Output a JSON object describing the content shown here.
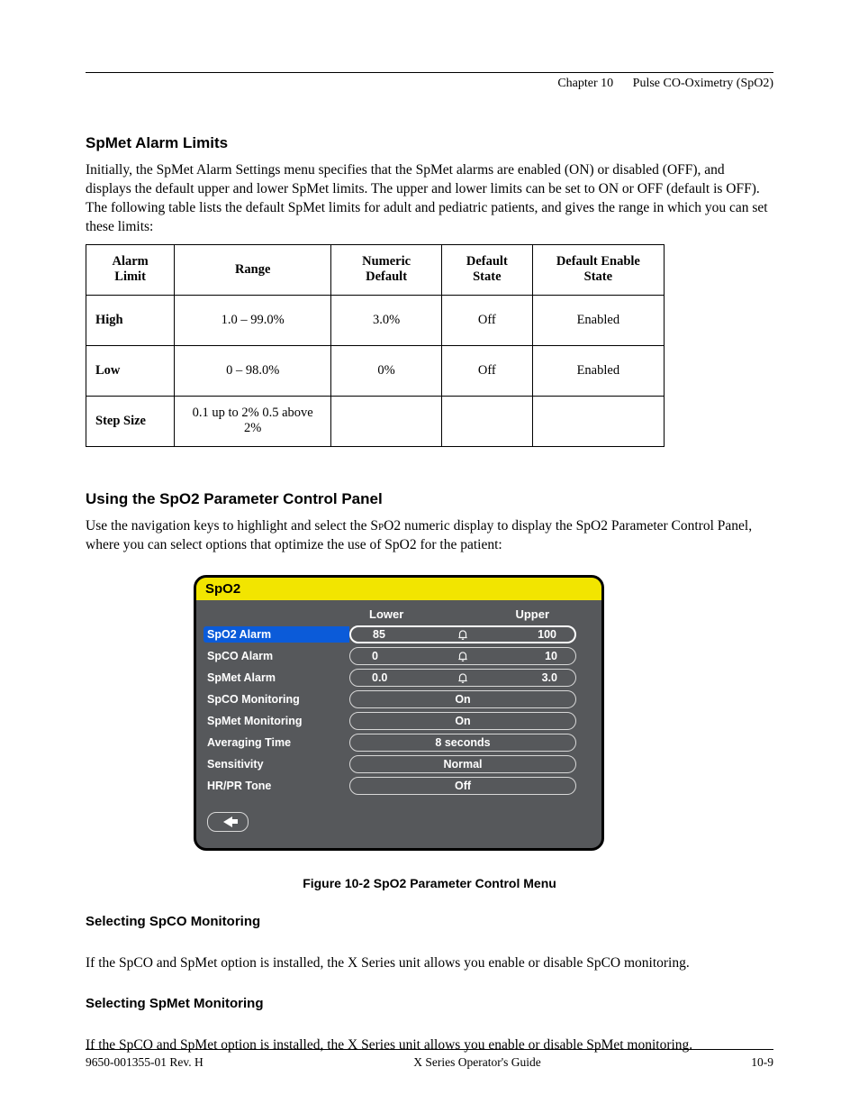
{
  "header": {
    "chapter": "Chapter 10",
    "section": "Pulse CO-Oximetry (SpO2)"
  },
  "spmet": {
    "title": "SpMet Alarm Limits",
    "intro": "Initially, the SpMet Alarm Settings menu specifies that the SpMet alarms are enabled (ON) or disabled (OFF), and displays the default upper and lower SpMet limits. The upper and lower limits can be set to ON or OFF (default is OFF). The following table lists the default SpMet limits for adult and pediatric patients, and gives the range in which you can set these limits:",
    "table": {
      "headers": [
        "Alarm Limit",
        "Range",
        "Numeric Default",
        "Default State",
        "Default Enable State"
      ],
      "rows": [
        {
          "label": "High",
          "range": "1.0 – 99.0%",
          "numeric_default": "3.0%",
          "default_state": "Off",
          "default_enable": "Enabled"
        },
        {
          "label": "Low",
          "range": "0 – 98.0%",
          "numeric_default": "0%",
          "default_state": "Off",
          "default_enable": "Enabled"
        },
        {
          "label": "Step Size",
          "range": "0.1 up to 2%\n0.5 above 2%",
          "numeric_default": "",
          "default_state": "",
          "default_enable": ""
        }
      ]
    }
  },
  "control_panel": {
    "title": "Using the SpO2 Parameter Control Panel",
    "intro_pre": "Use the navigation keys to highlight and select the ",
    "intro_small": "SpO2",
    "intro_post": " numeric display to display the SpO2 Parameter Control Panel, where you can select options that optimize the use of SpO2 for the patient:"
  },
  "panel": {
    "title": "SpO2",
    "columns": [
      "Lower",
      "Upper"
    ],
    "rows": [
      {
        "label": "SpO2 Alarm",
        "lower": "85",
        "upper": "100"
      },
      {
        "label": "SpCO Alarm",
        "lower": "0",
        "upper": "10"
      },
      {
        "label": "SpMet Alarm",
        "lower": "0.0",
        "upper": "3.0"
      },
      {
        "label": "SpCO Monitoring",
        "value": "On"
      },
      {
        "label": "SpMet Monitoring",
        "value": "On"
      },
      {
        "label": "Averaging Time",
        "value": "8 seconds"
      },
      {
        "label": "Sensitivity",
        "value": "Normal"
      },
      {
        "label": "HR/PR Tone",
        "value": "Off"
      }
    ]
  },
  "figure": {
    "caption": "Figure 10-2 SpO2 Parameter Control Menu"
  },
  "below": {
    "h1": "Selecting SpCO Monitoring",
    "p1": "If the SpCO and SpMet option is installed, the X Series unit allows you enable or disable SpCO monitoring.",
    "h2": "Selecting SpMet Monitoring",
    "p2": "If the SpCO and SpMet option is installed, the X Series unit allows you enable or disable SpMet monitoring."
  },
  "footer": {
    "left": "9650-001355-01 Rev. H",
    "center": "X Series Operator's Guide",
    "right": "10-9"
  }
}
